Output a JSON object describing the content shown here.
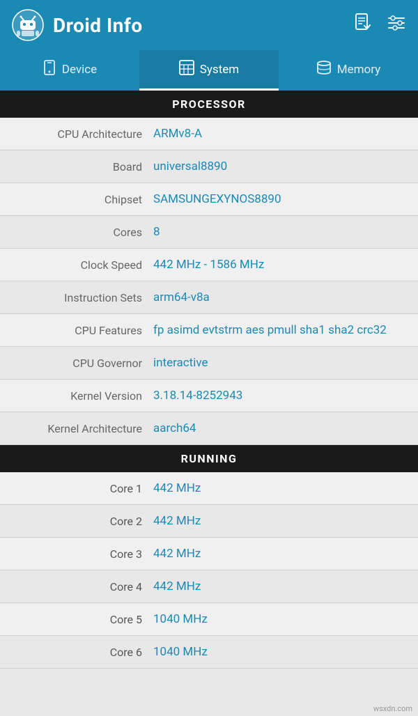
{
  "header": {
    "title": "Droid Info",
    "icon_alt": "droid-info-logo"
  },
  "tabs": [
    {
      "label": "Device",
      "icon": "📱",
      "active": false
    },
    {
      "label": "System",
      "icon": "🖥",
      "active": true
    },
    {
      "label": "Memory",
      "icon": "💾",
      "active": false
    }
  ],
  "processor_section": {
    "title": "PROCESSOR"
  },
  "processor_rows": [
    {
      "label": "CPU Architecture",
      "value": "ARMv8-A"
    },
    {
      "label": "Board",
      "value": "universal8890"
    },
    {
      "label": "Chipset",
      "value": "SAMSUNGEXYNOS8890"
    },
    {
      "label": "Cores",
      "value": "8"
    },
    {
      "label": "Clock Speed",
      "value": "442 MHz - 1586 MHz"
    },
    {
      "label": "Instruction Sets",
      "value": "arm64-v8a"
    },
    {
      "label": "CPU Features",
      "value": "fp asimd evtstrm aes pmull sha1 sha2 crc32"
    },
    {
      "label": "CPU Governor",
      "value": "interactive"
    },
    {
      "label": "Kernel Version",
      "value": "3.18.14-8252943"
    },
    {
      "label": "Kernel Architecture",
      "value": "aarch64"
    }
  ],
  "running_section": {
    "title": "RUNNING"
  },
  "cores": [
    {
      "label": "Core 1",
      "value": "442 MHz"
    },
    {
      "label": "Core 2",
      "value": "442 MHz"
    },
    {
      "label": "Core 3",
      "value": "442 MHz"
    },
    {
      "label": "Core 4",
      "value": "442 MHz"
    },
    {
      "label": "Core 5",
      "value": "1040 MHz"
    },
    {
      "label": "Core 6",
      "value": "1040 MHz"
    }
  ],
  "watermark": "wsxdn.com"
}
